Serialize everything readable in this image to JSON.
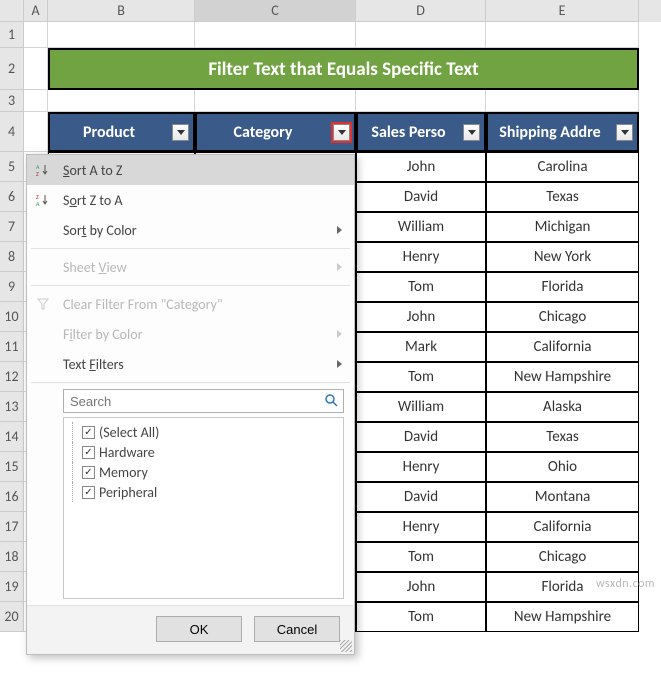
{
  "columns": [
    "A",
    "B",
    "C",
    "D",
    "E"
  ],
  "title": "Filter Text that Equals Specific Text",
  "headers": {
    "product": "Product",
    "category": "Category",
    "sales_person": "Sales Perso",
    "shipping": "Shipping Addre"
  },
  "rows": [
    {
      "n": "5",
      "d": "John",
      "e": "Carolina"
    },
    {
      "n": "6",
      "d": "David",
      "e": "Texas"
    },
    {
      "n": "7",
      "d": "William",
      "e": "Michigan"
    },
    {
      "n": "8",
      "d": "Henry",
      "e": "New York"
    },
    {
      "n": "9",
      "d": "Tom",
      "e": "Florida"
    },
    {
      "n": "10",
      "d": "John",
      "e": "Chicago"
    },
    {
      "n": "11",
      "d": "Mark",
      "e": "California"
    },
    {
      "n": "12",
      "d": "Tom",
      "e": "New Hampshire"
    },
    {
      "n": "13",
      "d": "William",
      "e": "Alaska"
    },
    {
      "n": "14",
      "d": "David",
      "e": "Texas"
    },
    {
      "n": "15",
      "d": "Henry",
      "e": "Ohio"
    },
    {
      "n": "16",
      "d": "David",
      "e": "Montana"
    },
    {
      "n": "17",
      "d": "Henry",
      "e": "California"
    },
    {
      "n": "18",
      "d": "Tom",
      "e": "Chicago"
    },
    {
      "n": "19",
      "d": "John",
      "e": "Florida"
    },
    {
      "n": "20",
      "d": "Tom",
      "e": "New Hampshire"
    }
  ],
  "menu": {
    "sort_az": "Sort A to Z",
    "sort_za": "Sort Z to A",
    "sort_color": "Sort by Color",
    "sheet_view": "Sheet View",
    "clear_filter": "Clear Filter From \"Category\"",
    "filter_color": "Filter by Color",
    "text_filters": "Text Filters",
    "search_placeholder": "Search",
    "items": {
      "select_all": "(Select All)",
      "hardware": "Hardware",
      "memory": "Memory",
      "peripheral": "Peripheral"
    },
    "ok": "OK",
    "cancel": "Cancel"
  },
  "row_labels_pre": [
    "1",
    "2",
    "3",
    "4"
  ],
  "watermark": "wsxdn.com"
}
